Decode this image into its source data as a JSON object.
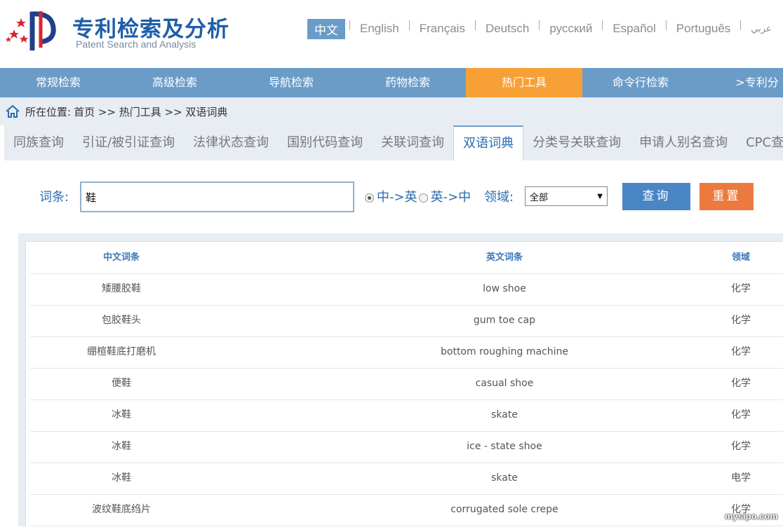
{
  "header": {
    "title": "专利检索及分析",
    "subtitle": "Patent Search and Analysis",
    "languages": [
      "中文",
      "English",
      "Français",
      "Deutsch",
      "русский",
      "Español",
      "Português",
      "عربي"
    ]
  },
  "nav": {
    "items": [
      "常规检索",
      "高级检索",
      "导航检索",
      "药物检索",
      "热门工具",
      "命令行检索",
      ">专利分"
    ],
    "active_index": 4
  },
  "breadcrumb": {
    "label": "所在位置:",
    "path": "首页 >> 热门工具 >> 双语词典"
  },
  "tabs": {
    "items": [
      "同族查询",
      "引证/被引证查询",
      "法律状态查询",
      "国别代码查询",
      "关联词查询",
      "双语词典",
      "分类号关联查询",
      "申请人别名查询",
      "CPC查"
    ],
    "active_index": 5
  },
  "search": {
    "term_label": "词条:",
    "term_value": "鞋",
    "radio_zh_en": "中->英",
    "radio_en_zh": "英->中",
    "selected_direction": "中->英",
    "field_label": "领域:",
    "field_value": "全部",
    "query_button": "查询",
    "reset_button": "重置"
  },
  "table": {
    "headers": [
      "中文词条",
      "英文词条",
      "领域"
    ],
    "rows": [
      [
        "矮腰胶鞋",
        "low shoe",
        "化学"
      ],
      [
        "包胶鞋头",
        "gum toe cap",
        "化学"
      ],
      [
        "绷楦鞋底打磨机",
        "bottom roughing machine",
        "化学"
      ],
      [
        "便鞋",
        "casual shoe",
        "化学"
      ],
      [
        "冰鞋",
        "skate",
        "化学"
      ],
      [
        "冰鞋",
        "ice - state shoe",
        "化学"
      ],
      [
        "冰鞋",
        "skate",
        "电学"
      ],
      [
        "波纹鞋底绉片",
        "corrugated sole crepe",
        "化学"
      ]
    ]
  },
  "watermark": "mysipo.com",
  "colors": {
    "nav_bg": "#6b9cc8",
    "nav_active": "#f7a036",
    "brand_blue": "#1f5ea8",
    "query_btn": "#4a86c6",
    "reset_btn": "#ec7a3f"
  }
}
